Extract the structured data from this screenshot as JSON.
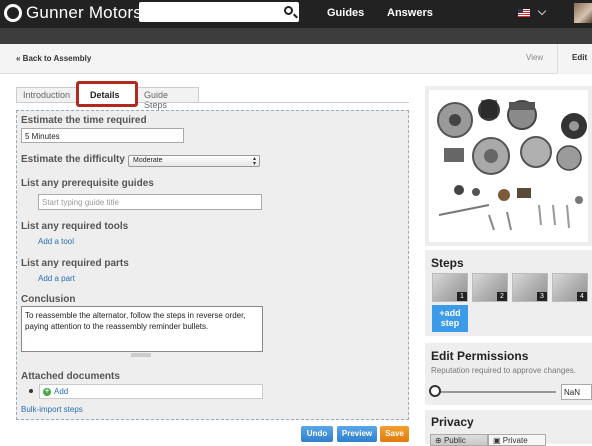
{
  "header": {
    "logo": "Gunner Motors",
    "nav": [
      "Guides",
      "Answers"
    ],
    "search_placeholder": ""
  },
  "subbar": {
    "back": "« Back to Assembly",
    "view": "View",
    "edit": "Edit"
  },
  "tabs": [
    {
      "label": "Introduction"
    },
    {
      "label": "Details",
      "active": true
    },
    {
      "label": "Guide Steps"
    }
  ],
  "form": {
    "time_label": "Estimate the time required",
    "time_value": "5 Minutes",
    "difficulty_label": "Estimate the difficulty",
    "difficulty_value": "Moderate",
    "prereq_label": "List any prerequisite guides",
    "prereq_placeholder": "Start typing guide title",
    "tools_label": "List any required tools",
    "add_tool": "Add a tool",
    "parts_label": "List any required parts",
    "add_part": "Add a part",
    "conclusion_label": "Conclusion",
    "conclusion_value": "To reassemble the alternator, follow the steps in reverse order, paying attention to the reassembly reminder bullets.",
    "attached_label": "Attached documents",
    "attach_add": "Add",
    "bulk_import": "Bulk-import steps"
  },
  "buttons": {
    "undo": "Undo",
    "preview": "Preview",
    "save": "Save"
  },
  "sidebar": {
    "steps_title": "Steps",
    "step_numbers": [
      "1",
      "2",
      "3",
      "4"
    ],
    "add_step": "+add step",
    "permissions_title": "Edit Permissions",
    "permissions_hint": "Reputation required to approve changes.",
    "reputation_value": "NaN",
    "privacy_title": "Privacy",
    "privacy_public": "Public",
    "privacy_private": "Private"
  },
  "colors": {
    "header_bg": "#222222",
    "link": "#2a6fb5",
    "highlight_box": "#b02a1f",
    "save_button": "#e07b10",
    "blue_button": "#2f7fcf"
  }
}
